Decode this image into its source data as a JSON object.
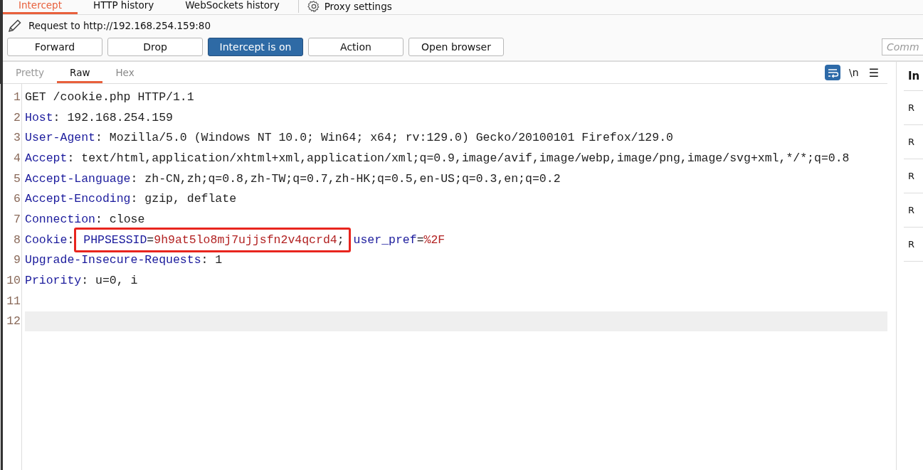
{
  "proxy_tabs": [
    {
      "label": "Intercept",
      "selected": true
    },
    {
      "label": "HTTP history",
      "selected": false
    },
    {
      "label": "WebSockets history",
      "selected": false
    }
  ],
  "proxy_settings": "Proxy settings",
  "request_target": "Request to http://192.168.254.159:80",
  "buttons": [
    {
      "label": "Forward",
      "on": false
    },
    {
      "label": "Drop",
      "on": false
    },
    {
      "label": "Intercept is on",
      "on": true
    },
    {
      "label": "Action",
      "on": false
    },
    {
      "label": "Open browser",
      "on": false
    }
  ],
  "comment_field": {
    "placeholder": "Comm"
  },
  "editor_tabs": [
    {
      "label": "Pretty",
      "selected": false
    },
    {
      "label": "Raw",
      "selected": true
    },
    {
      "label": "Hex",
      "selected": false
    }
  ],
  "wrap_toggle": {
    "on": true
  },
  "newline_toggle": "\\n",
  "menu_glyph": "☰",
  "lines": [
    {
      "number": "1",
      "parts": [
        {
          "kind": "plain",
          "text": "GET /cookie.php HTTP/1.1"
        }
      ]
    },
    {
      "number": "2",
      "parts": [
        {
          "kind": "key",
          "text": "Host"
        },
        {
          "kind": "plain",
          "text": ": 192.168.254.159"
        }
      ]
    },
    {
      "number": "3",
      "parts": [
        {
          "kind": "key",
          "text": "User-Agent"
        },
        {
          "kind": "plain",
          "text": ": Mozilla/5.0 (Windows NT 10.0; Win64; x64; rv:129.0) Gecko/20100101 Firefox/129.0"
        }
      ]
    },
    {
      "number": "4",
      "parts": [
        {
          "kind": "key",
          "text": "Accept"
        },
        {
          "kind": "plain",
          "text": ": text/html,application/xhtml+xml,application/xml;q=0.9,image/avif,image/webp,image/png,image/svg+xml,*/*;q=0.8"
        }
      ]
    },
    {
      "number": "5",
      "parts": [
        {
          "kind": "key",
          "text": "Accept-Language"
        },
        {
          "kind": "plain",
          "text": ": zh-CN,zh;q=0.8,zh-TW;q=0.7,zh-HK;q=0.5,en-US;q=0.3,en;q=0.2"
        }
      ]
    },
    {
      "number": "6",
      "parts": [
        {
          "kind": "key",
          "text": "Accept-Encoding"
        },
        {
          "kind": "plain",
          "text": ": gzip, deflate"
        }
      ]
    },
    {
      "number": "7",
      "parts": [
        {
          "kind": "key",
          "text": "Connection"
        },
        {
          "kind": "plain",
          "text": ": close"
        }
      ]
    },
    {
      "number": "8",
      "parts": [
        {
          "kind": "key",
          "text": "Cookie"
        },
        {
          "kind": "plain",
          "text": ": "
        },
        {
          "kind": "group",
          "boxed": true,
          "parts": [
            {
              "kind": "name",
              "text": "PHPSESSID"
            },
            {
              "kind": "plain",
              "text": "="
            },
            {
              "kind": "value",
              "text": "9h9at5lo8mj7ujjsfn2v4qcrd4"
            },
            {
              "kind": "plain",
              "text": ";"
            }
          ]
        },
        {
          "kind": "name",
          "text": " user_pref"
        },
        {
          "kind": "plain",
          "text": "="
        },
        {
          "kind": "value",
          "text": "%2F"
        }
      ]
    },
    {
      "number": "9",
      "parts": [
        {
          "kind": "key",
          "text": "Upgrade-Insecure-Requests"
        },
        {
          "kind": "plain",
          "text": ": 1"
        }
      ]
    },
    {
      "number": "10",
      "parts": [
        {
          "kind": "key",
          "text": "Priority"
        },
        {
          "kind": "plain",
          "text": ": u=0, i"
        }
      ]
    },
    {
      "number": "11",
      "current": false
    },
    {
      "number": "12",
      "current": true
    }
  ],
  "inspector": {
    "title": "In",
    "rows": [
      "R",
      "R",
      "R",
      "R",
      "R"
    ]
  }
}
